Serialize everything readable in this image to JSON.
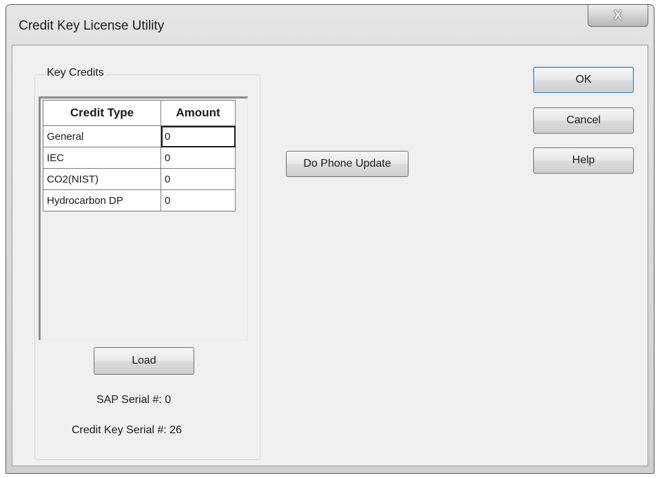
{
  "window": {
    "title": "Credit Key License Utility",
    "close_glyph": "X"
  },
  "group": {
    "label": "Key Credits"
  },
  "table": {
    "headers": [
      "Credit Type",
      "Amount"
    ],
    "rows": [
      {
        "type": "General",
        "amount": "0"
      },
      {
        "type": "IEC",
        "amount": "0"
      },
      {
        "type": "CO2(NIST)",
        "amount": "0"
      },
      {
        "type": "Hydrocarbon DP",
        "amount": "0"
      }
    ]
  },
  "buttons": {
    "load": "Load",
    "phone_update": "Do Phone Update",
    "ok": "OK",
    "cancel": "Cancel",
    "help": "Help"
  },
  "info": {
    "sap_serial": "SAP Serial #: 0",
    "credit_key_serial": "Credit Key Serial #: 26"
  }
}
